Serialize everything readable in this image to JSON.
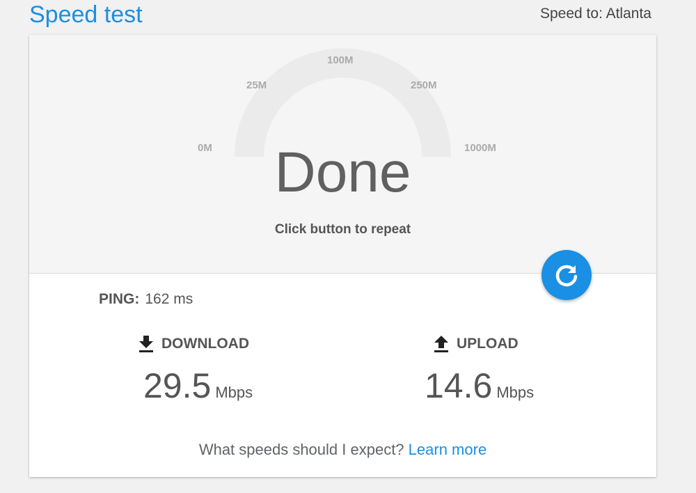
{
  "header": {
    "title": "Speed test",
    "speed_to": "Speed to: Atlanta"
  },
  "gauge": {
    "ticks": [
      "0M",
      "25M",
      "100M",
      "250M",
      "1000M"
    ],
    "status": "Done",
    "hint": "Click button to repeat",
    "repeat_icon": "refresh-icon"
  },
  "results": {
    "ping_label": "PING:",
    "ping_value": "162 ms",
    "download_label": "DOWNLOAD",
    "download_value": "29.5",
    "download_unit": "Mbps",
    "upload_label": "UPLOAD",
    "upload_value": "14.6",
    "upload_unit": "Mbps"
  },
  "footer": {
    "question": "What speeds should I expect?",
    "link": "Learn more"
  },
  "colors": {
    "accent": "#1a8fe3",
    "gauge_track": "#ebebeb"
  }
}
